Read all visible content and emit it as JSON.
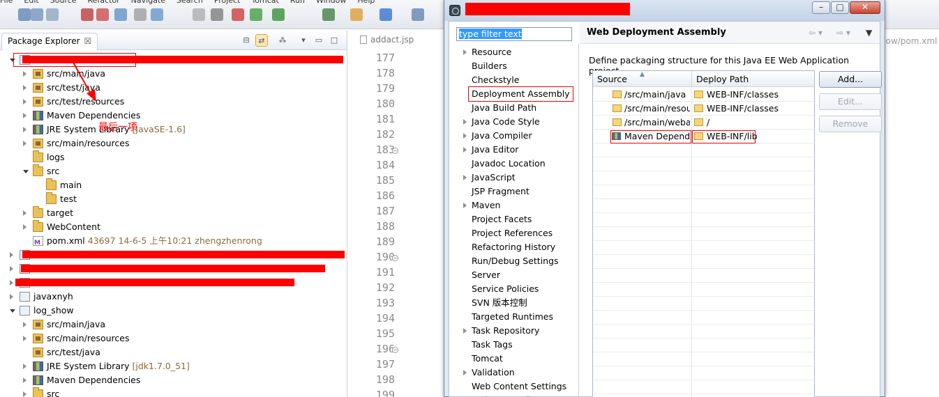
{
  "menu": [
    "File",
    "Edit",
    "Source",
    "Refactor",
    "Navigate",
    "Search",
    "Project",
    "Tomcat",
    "Run",
    "Window",
    "Help"
  ],
  "package_explorer": {
    "tab_label": "Package Explorer",
    "tab_close": "☒",
    "tree": [
      {
        "label": "",
        "icon": "maven-project-icon",
        "expanded": true,
        "redacted": true
      },
      {
        "label": "src/main/java",
        "icon": "package-folder-icon"
      },
      {
        "label": "src/test/java",
        "icon": "package-folder-icon"
      },
      {
        "label": "src/test/resources",
        "icon": "package-folder-icon"
      },
      {
        "label": "Maven Dependencies",
        "icon": "library-icon"
      },
      {
        "label": "JRE System Library",
        "decor": "[JavaSE-1.6]",
        "icon": "library-icon"
      },
      {
        "label": "src/main/resources",
        "icon": "package-folder-icon"
      },
      {
        "label": "logs",
        "icon": "folder-icon"
      },
      {
        "label": "src",
        "icon": "folder-icon",
        "expanded": true
      },
      {
        "label": "main",
        "icon": "folder-icon"
      },
      {
        "label": "test",
        "icon": "folder-icon"
      },
      {
        "label": "target",
        "icon": "folder-icon"
      },
      {
        "label": "WebContent",
        "icon": "folder-icon"
      },
      {
        "label": "pom.xml",
        "decor": "43697  14-6-5 上午10:21  zhengzhenrong",
        "icon": "xml-file-icon"
      },
      {
        "label": "",
        "icon": "maven-project-icon",
        "redacted": true
      },
      {
        "label": "",
        "icon": "maven-project-icon",
        "redacted": true
      },
      {
        "label": "",
        "icon": "maven-project-icon",
        "redacted": true
      },
      {
        "label": "javaxnyh",
        "icon": "project-icon"
      },
      {
        "label": "log_show",
        "icon": "project-icon",
        "expanded": true
      },
      {
        "label": "src/main/java",
        "icon": "package-folder-icon"
      },
      {
        "label": "src/main/resources",
        "icon": "package-folder-icon"
      },
      {
        "label": "src/test/java",
        "icon": "package-folder-icon"
      },
      {
        "label": "JRE System Library",
        "decor": "[jdk1.7.0_51]",
        "icon": "library-icon"
      },
      {
        "label": "Maven Dependencies",
        "icon": "library-icon"
      },
      {
        "label": "src",
        "icon": "folder-icon"
      }
    ],
    "annotation": "最后一项"
  },
  "editor": {
    "tab_label": "addact.jsp",
    "right_tab_label": "how/pom.xml",
    "line_numbers": [
      "177",
      "178",
      "179",
      "180",
      "181",
      "182",
      "183",
      "184",
      "185",
      "186",
      "187",
      "188",
      "189",
      "190",
      "191",
      "192",
      "193",
      "194",
      "195",
      "196",
      "197",
      "198",
      "199"
    ],
    "fold_markers": [
      "183",
      "190",
      "196"
    ]
  },
  "dialog": {
    "title": "",
    "window_buttons": {
      "minimize": "–",
      "maximize": "□",
      "close": "✕"
    },
    "filter": {
      "value": "type filter text"
    },
    "nav_items": [
      {
        "label": "Resource",
        "expandable": true
      },
      {
        "label": "Builders"
      },
      {
        "label": "Checkstyle"
      },
      {
        "label": "Deployment Assembly",
        "selected": true
      },
      {
        "label": "Java Build Path"
      },
      {
        "label": "Java Code Style",
        "expandable": true
      },
      {
        "label": "Java Compiler",
        "expandable": true
      },
      {
        "label": "Java Editor",
        "expandable": true
      },
      {
        "label": "Javadoc Location"
      },
      {
        "label": "JavaScript",
        "expandable": true
      },
      {
        "label": "JSP Fragment"
      },
      {
        "label": "Maven",
        "expandable": true
      },
      {
        "label": "Project Facets"
      },
      {
        "label": "Project References"
      },
      {
        "label": "Refactoring History"
      },
      {
        "label": "Run/Debug Settings"
      },
      {
        "label": "Server"
      },
      {
        "label": "Service Policies"
      },
      {
        "label": "SVN 版本控制"
      },
      {
        "label": "Targeted Runtimes"
      },
      {
        "label": "Task Repository",
        "expandable": true
      },
      {
        "label": "Task Tags"
      },
      {
        "label": "Tomcat"
      },
      {
        "label": "Validation",
        "expandable": true
      },
      {
        "label": "Web Content Settings"
      },
      {
        "label": "Web Page Editor"
      }
    ],
    "page_title": "Web Deployment Assembly",
    "page_description": "Define packaging structure for this Java EE Web Application project.",
    "table": {
      "columns": [
        "Source",
        "Deploy Path"
      ],
      "rows": [
        {
          "source": "/src/main/java",
          "deploy": "WEB-INF/classes",
          "icon": "folder-icon"
        },
        {
          "source": "/src/main/resources",
          "deploy": "WEB-INF/classes",
          "icon": "folder-icon"
        },
        {
          "source": "/src/main/webapp",
          "deploy": "/",
          "icon": "folder-icon"
        },
        {
          "source": "Maven Dependencies",
          "deploy": "WEB-INF/lib",
          "icon": "library-icon"
        }
      ]
    },
    "buttons": {
      "add": "Add...",
      "edit": "Edit...",
      "remove": "Remove"
    }
  }
}
